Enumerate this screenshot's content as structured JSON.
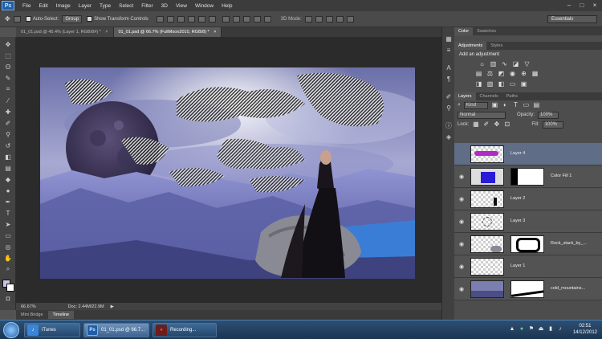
{
  "menubar": {
    "app_icon": "Ps",
    "items": [
      "File",
      "Edit",
      "Image",
      "Layer",
      "Type",
      "Select",
      "Filter",
      "3D",
      "View",
      "Window",
      "Help"
    ]
  },
  "options": {
    "auto_select_label": "Auto-Select:",
    "auto_select_value": "Group",
    "transform_label": "Show Transform Controls",
    "mode3d_label": "3D Mode:",
    "workspace": "Essentials"
  },
  "tabs": [
    {
      "label": "01_01.psd @ 45.4% (Layer 1, RGB/8#) *",
      "close": "×"
    },
    {
      "label": "01_01.psd @ 66.7% (FullMoon2010, RGB/8) *",
      "close": "×"
    }
  ],
  "status": {
    "zoom": "66.67%",
    "doc": "Doc: 2.44M/22.9M",
    "arrow": "▶"
  },
  "bottom_tabs": [
    "Mini Bridge",
    "Timeline"
  ],
  "panels": {
    "top_tabs": [
      "Color",
      "Swatches"
    ],
    "adj_tabs": [
      "Adjustments",
      "Styles"
    ],
    "adj_title": "Add an adjustment",
    "layer_tabs": [
      "Layers",
      "Channels",
      "Paths"
    ],
    "filter_kind": "Kind",
    "blend_mode": "Normal",
    "opacity_label": "Opacity:",
    "opacity_value": "100%",
    "lock_label": "Lock:",
    "fill_label": "Fill:",
    "fill_value": "100%",
    "layers": [
      {
        "name": "Layer 4",
        "visible": false,
        "selected": true
      },
      {
        "name": "Color Fill 1",
        "visible": true,
        "selected": false
      },
      {
        "name": "Layer 2",
        "visible": true,
        "selected": false
      },
      {
        "name": "Layer 3",
        "visible": true,
        "selected": false
      },
      {
        "name": "Rock_stack_by_...",
        "visible": true,
        "selected": false
      },
      {
        "name": "Layer 1",
        "visible": true,
        "selected": false
      },
      {
        "name": "cold_mountains...",
        "visible": true,
        "selected": false
      }
    ]
  },
  "taskbar": {
    "apps": [
      {
        "label": "iTunes",
        "icon": "♪",
        "active": false
      },
      {
        "label": "01_01.psd @ 66.7...",
        "icon": "Ps",
        "active": true
      },
      {
        "label": "Recording...",
        "icon": "●",
        "active": false
      }
    ],
    "clock_time": "02:51",
    "clock_date": "14/12/2012"
  },
  "colors": {
    "accent": "#1e5fa8",
    "selected_layer": "#5f6d86"
  },
  "icons": [
    "move-tool-icon",
    "marquee-tool-icon",
    "lasso-tool-icon",
    "crop-tool-icon",
    "brush-tool-icon",
    "eye-icon",
    "search-icon",
    "settings-icon"
  ]
}
